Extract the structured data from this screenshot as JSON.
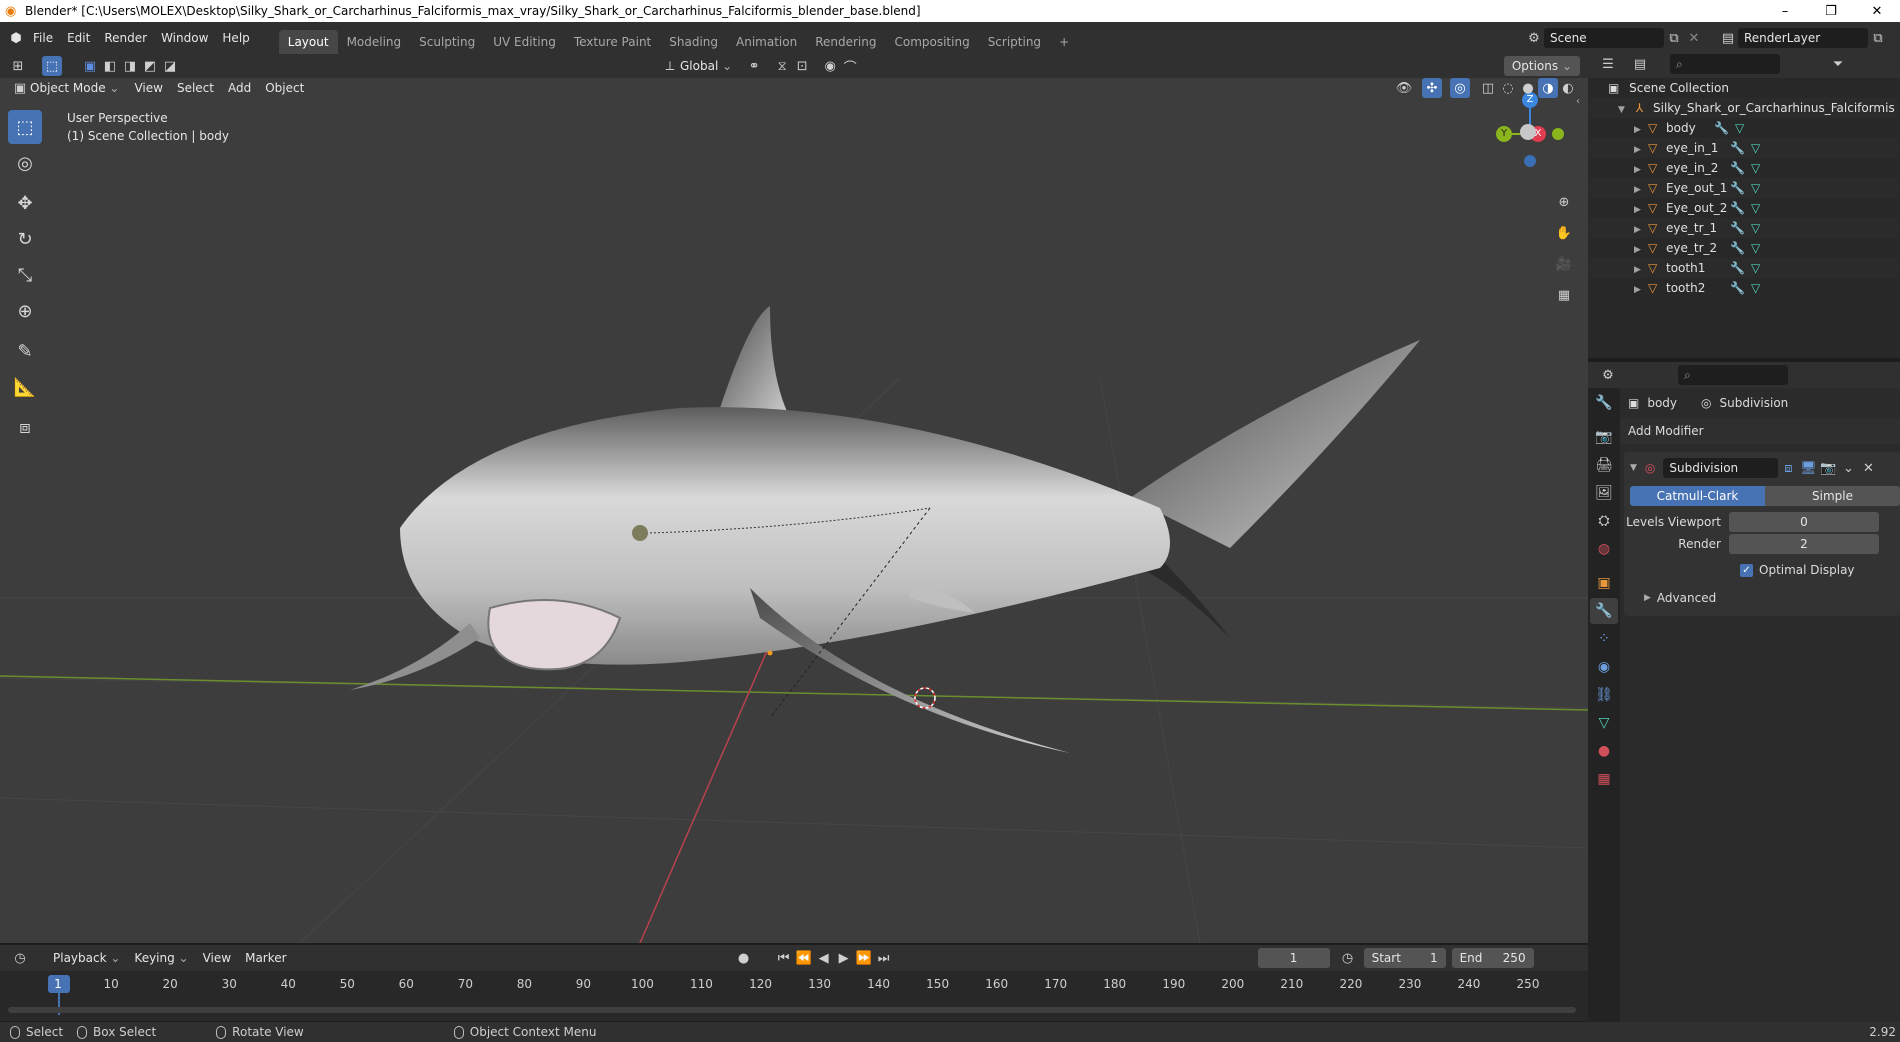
{
  "titlebar": {
    "title": "Blender* [C:\\Users\\MOLEX\\Desktop\\Silky_Shark_or_Carcharhinus_Falciformis_max_vray/Silky_Shark_or_Carcharhinus_Falciformis_blender_base.blend]",
    "minimize": "–",
    "restore": "❐",
    "close": "✕"
  },
  "menu": [
    "File",
    "Edit",
    "Render",
    "Window",
    "Help"
  ],
  "workspaces": [
    "Layout",
    "Modeling",
    "Sculpting",
    "UV Editing",
    "Texture Paint",
    "Shading",
    "Animation",
    "Rendering",
    "Compositing",
    "Scripting",
    "+"
  ],
  "scene": {
    "name": "Scene",
    "render_layer": "RenderLayer"
  },
  "viewport_header": {
    "mode": "Object Mode",
    "menus": [
      "View",
      "Select",
      "Add",
      "Object"
    ],
    "orientation": "Global",
    "options": "Options"
  },
  "viewport": {
    "perspective": "User Perspective",
    "collection": "(1) Scene Collection | body",
    "gizmo": {
      "z": "Z",
      "y": "Y",
      "x": "X"
    }
  },
  "outliner": {
    "root": "Scene Collection",
    "collection": "Silky_Shark_or_Carcharhinus_Falciformis",
    "items": [
      "body",
      "eye_in_1",
      "eye_in_2",
      "Eye_out_1",
      "Eye_out_2",
      "eye_tr_1",
      "eye_tr_2",
      "tooth1",
      "tooth2"
    ]
  },
  "properties": {
    "object": "body",
    "modifier_context": "Subdivision",
    "add_modifier": "Add Modifier",
    "modifier_name": "Subdivision",
    "seg_left": "Catmull-Clark",
    "seg_right": "Simple",
    "levels_viewport_label": "Levels Viewport",
    "levels_viewport": "0",
    "render_label": "Render",
    "render": "2",
    "optimal_display": "Optimal Display",
    "advanced": "Advanced"
  },
  "timeline": {
    "menus": [
      "Playback",
      "Keying",
      "View",
      "Marker"
    ],
    "current_frame": "1",
    "start_label": "Start",
    "start": "1",
    "end_label": "End",
    "end": "250",
    "ticks": [
      "1",
      "10",
      "20",
      "30",
      "40",
      "50",
      "60",
      "70",
      "80",
      "90",
      "100",
      "110",
      "120",
      "130",
      "140",
      "150",
      "160",
      "170",
      "180",
      "190",
      "200",
      "210",
      "220",
      "230",
      "240",
      "250"
    ]
  },
  "statusbar": {
    "select": "Select",
    "box_select": "Box Select",
    "rotate_view": "Rotate View",
    "context_menu": "Object Context Menu",
    "version": "2.92"
  }
}
